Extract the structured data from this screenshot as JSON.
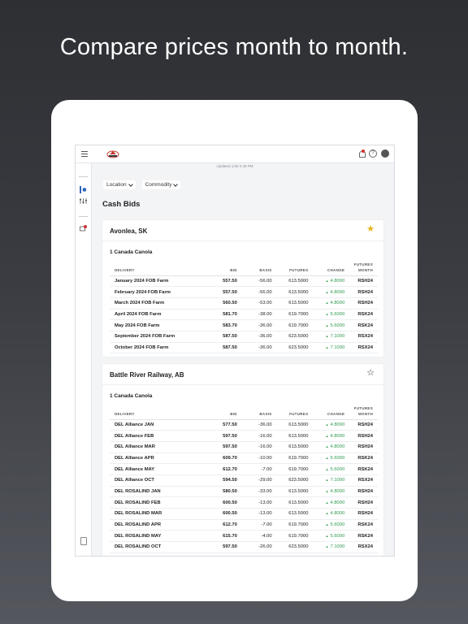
{
  "headline": "Compare prices month to month.",
  "app": {
    "updated": "Updated 1/30 2:49 PM",
    "filters": [
      {
        "label": "Location"
      },
      {
        "label": "Commodity"
      }
    ],
    "page_title": "Cash Bids",
    "columns": [
      "DELIVERY",
      "BID",
      "BASIS",
      "FUTURES",
      "CHANGE",
      "FUTURES MONTH"
    ],
    "columns_month_line1": "FUTURES",
    "columns_month_line2": "MONTH",
    "accent": "#3066be",
    "change_color": "#2e9a4f",
    "star_color": "#e8b21a",
    "locations": [
      {
        "name": "Avonlea, SK",
        "favorite": true,
        "star_icon": "star-filled-icon",
        "commodity": "1 Canada Canola",
        "rows": [
          {
            "delivery": "January 2024 FOB Farm",
            "bid": "557.50",
            "basis": "-56.00",
            "futures": "613.5000",
            "change": "4.8000",
            "month": "RSH24"
          },
          {
            "delivery": "February 2024 FOB Farm",
            "bid": "557.50",
            "basis": "-56.00",
            "futures": "613.5000",
            "change": "4.8000",
            "month": "RSH24"
          },
          {
            "delivery": "March 2024 FOB Farm",
            "bid": "560.50",
            "basis": "-53.00",
            "futures": "613.5000",
            "change": "4.8000",
            "month": "RSH24"
          },
          {
            "delivery": "April 2024 FOB Farm",
            "bid": "581.70",
            "basis": "-38.00",
            "futures": "619.7000",
            "change": "5.6000",
            "month": "RSK24"
          },
          {
            "delivery": "May 2024 FOB Farm",
            "bid": "583.70",
            "basis": "-36.00",
            "futures": "619.7000",
            "change": "5.6000",
            "month": "RSK24"
          },
          {
            "delivery": "September 2024 FOB Farm",
            "bid": "587.50",
            "basis": "-36.00",
            "futures": "623.5000",
            "change": "7.1000",
            "month": "RSX24"
          },
          {
            "delivery": "October 2024 FOB Farm",
            "bid": "587.50",
            "basis": "-36.00",
            "futures": "623.5000",
            "change": "7.1000",
            "month": "RSX24"
          }
        ]
      },
      {
        "name": "Battle River Railway, AB",
        "favorite": false,
        "star_icon": "star-outline-icon",
        "commodity": "1 Canada Canola",
        "rows": [
          {
            "delivery": "DEL Alliance JAN",
            "bid": "577.50",
            "basis": "-36.00",
            "futures": "613.5000",
            "change": "4.8000",
            "month": "RSH24"
          },
          {
            "delivery": "DEL Alliance FEB",
            "bid": "597.50",
            "basis": "-16.00",
            "futures": "613.5000",
            "change": "4.8000",
            "month": "RSH24"
          },
          {
            "delivery": "DEL Alliance MAR",
            "bid": "597.50",
            "basis": "-16.00",
            "futures": "613.5000",
            "change": "4.8000",
            "month": "RSH24"
          },
          {
            "delivery": "DEL Alliance APR",
            "bid": "609.70",
            "basis": "-10.00",
            "futures": "619.7000",
            "change": "5.6000",
            "month": "RSK24"
          },
          {
            "delivery": "DEL Alliance MAY",
            "bid": "612.70",
            "basis": "-7.00",
            "futures": "619.7000",
            "change": "5.6000",
            "month": "RSK24"
          },
          {
            "delivery": "DEL Alliance OCT",
            "bid": "594.50",
            "basis": "-29.00",
            "futures": "623.5000",
            "change": "7.1000",
            "month": "RSX24"
          },
          {
            "delivery": "DEL ROSALIND JAN",
            "bid": "580.50",
            "basis": "-33.00",
            "futures": "613.5000",
            "change": "4.8000",
            "month": "RSH24"
          },
          {
            "delivery": "DEL ROSALIND FEB",
            "bid": "600.50",
            "basis": "-13.00",
            "futures": "613.5000",
            "change": "4.8000",
            "month": "RSH24"
          },
          {
            "delivery": "DEL ROSALIND MAR",
            "bid": "600.50",
            "basis": "-13.00",
            "futures": "613.5000",
            "change": "4.8000",
            "month": "RSH24"
          },
          {
            "delivery": "DEL ROSALIND APR",
            "bid": "612.70",
            "basis": "-7.00",
            "futures": "619.7000",
            "change": "5.6000",
            "month": "RSK24"
          },
          {
            "delivery": "DEL ROSALIND MAY",
            "bid": "615.70",
            "basis": "-4.00",
            "futures": "619.7000",
            "change": "5.6000",
            "month": "RSK24"
          },
          {
            "delivery": "DEL ROSALIND OCT",
            "bid": "597.50",
            "basis": "-26.00",
            "futures": "623.5000",
            "change": "7.1000",
            "month": "RSX24"
          }
        ]
      }
    ]
  }
}
